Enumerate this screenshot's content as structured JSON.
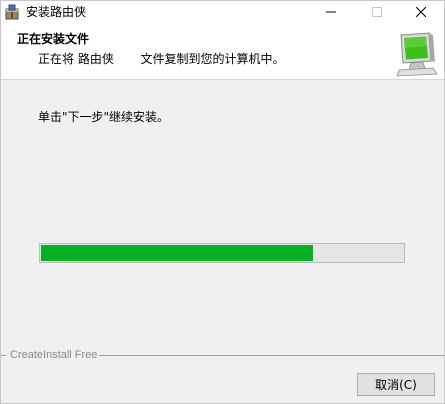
{
  "window": {
    "title": "安装路由侠",
    "icon": "installer-box-icon"
  },
  "header": {
    "title": "正在安装文件",
    "subtitle": "正在将 路由侠       文件复制到您的计算机中。",
    "icon": "computer-monitor-icon"
  },
  "body": {
    "instruction": "单击\"下一步\"继续安装。"
  },
  "progress": {
    "percent": 75,
    "fill_color": "#06b025"
  },
  "footer": {
    "brand": "CreateInstall Free",
    "cancel_label": "取消(C)"
  }
}
